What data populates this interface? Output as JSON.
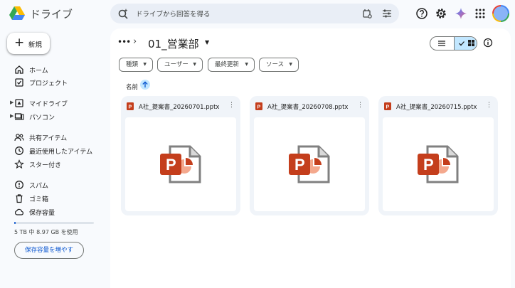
{
  "app": {
    "title": "ドライブ"
  },
  "search": {
    "placeholder": "ドライブから回答を得る"
  },
  "sidebar": {
    "new_label": "新規",
    "items": [
      {
        "label": "ホーム",
        "icon": "home-icon"
      },
      {
        "label": "プロジェクト",
        "icon": "project-icon"
      },
      {
        "label": "マイドライブ",
        "icon": "my-drive-icon",
        "expandable": true
      },
      {
        "label": "パソコン",
        "icon": "computer-icon",
        "expandable": true
      },
      {
        "label": "共有アイテム",
        "icon": "shared-icon"
      },
      {
        "label": "最近使用したアイテム",
        "icon": "recent-icon"
      },
      {
        "label": "スター付き",
        "icon": "star-icon"
      },
      {
        "label": "スパム",
        "icon": "spam-icon"
      },
      {
        "label": "ゴミ箱",
        "icon": "trash-icon"
      },
      {
        "label": "保存容量",
        "icon": "cloud-icon"
      }
    ],
    "storage_text": "5 TB 中 8.97 GB を使用",
    "storage_fraction": 0.0018,
    "buy_storage_label": "保存容量を増やす"
  },
  "main": {
    "folder_title": "01_営業部",
    "filters": [
      "種類",
      "ユーザー",
      "最終更新",
      "ソース"
    ],
    "sort_label": "名前",
    "files": [
      {
        "name": "A社_提案書_20260701.pptx"
      },
      {
        "name": "A社_提案書_20260708.pptx"
      },
      {
        "name": "A社_提案書_20260715.pptx"
      }
    ]
  },
  "colors": {
    "accent": "#0b57d0",
    "selected": "#c2e7ff",
    "powerpoint": "#c43e1c"
  }
}
